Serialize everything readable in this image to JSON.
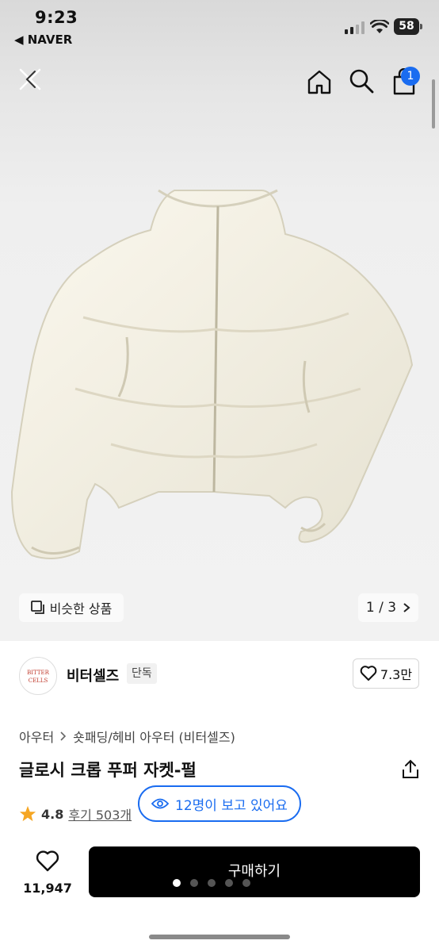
{
  "status_bar": {
    "time": "9:23",
    "back_app": "◀ NAVER",
    "battery": "58"
  },
  "header": {
    "cart_badge": "1"
  },
  "gallery": {
    "similar_label": "비슷한 상품",
    "page_indicator": "1 / 3"
  },
  "brand": {
    "logo_line1": "BITTER",
    "logo_line2": "CELLS",
    "name": "비터셀즈",
    "tag": "단독",
    "likes": "7.3만"
  },
  "breadcrumb": {
    "level1": "아우터",
    "level2": "숏패딩/헤비 아우터 (비터셀즈)"
  },
  "product": {
    "title": "글로시 크롭 푸퍼 자켓-펄",
    "rating": "4.8",
    "reviews": "후기 503개"
  },
  "viewers": {
    "text": "12명이 보고 있어요"
  },
  "bottom": {
    "wish_count": "11,947",
    "buy_label": "구매하기"
  },
  "colors": {
    "accent": "#1a6cf0",
    "buy_button": "#000000",
    "star": "#f5a623"
  }
}
